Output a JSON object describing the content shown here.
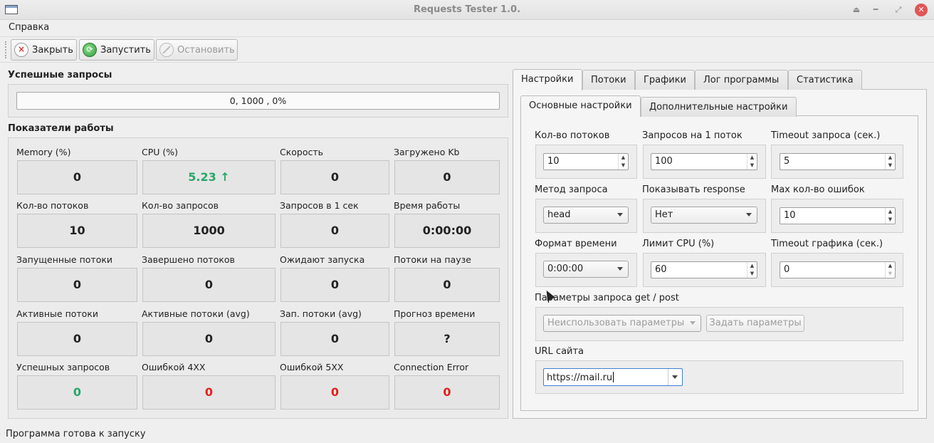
{
  "window": {
    "title": "Requests Tester 1.0."
  },
  "menu": {
    "help": "Справка"
  },
  "toolbar": {
    "close": "Закрыть",
    "run": "Запустить",
    "stop": "Остановить"
  },
  "success_group": {
    "title": "Успешные запросы",
    "progress_text": "0, 1000 , 0%",
    "progress_fraction": 0
  },
  "metrics": {
    "title": "Показатели работы",
    "items": [
      {
        "label": "Memory (%)",
        "value": "0"
      },
      {
        "label": "CPU (%)",
        "value": "5.23 ↑"
      },
      {
        "label": "Скорость",
        "value": "0"
      },
      {
        "label": "Загружено Kb",
        "value": "0"
      },
      {
        "label": "Кол-во потоков",
        "value": "10"
      },
      {
        "label": "Кол-во запросов",
        "value": "1000"
      },
      {
        "label": "Запросов в 1 сек",
        "value": "0"
      },
      {
        "label": "Время работы",
        "value": "0:00:00"
      },
      {
        "label": "Запущенные потоки",
        "value": "0"
      },
      {
        "label": "Завершено потоков",
        "value": "0"
      },
      {
        "label": "Ожидают запуска",
        "value": "0"
      },
      {
        "label": "Потоки на паузе",
        "value": "0"
      },
      {
        "label": "Активные потоки",
        "value": "0"
      },
      {
        "label": "Активные потоки (avg)",
        "value": "0"
      },
      {
        "label": "Зап. потоки (avg)",
        "value": "0"
      },
      {
        "label": "Прогноз времени",
        "value": "?"
      },
      {
        "label": "Успешных запросов",
        "value": "0"
      },
      {
        "label": "Ошибкой 4XX",
        "value": "0"
      },
      {
        "label": "Ошибкой 5XX",
        "value": "0"
      },
      {
        "label": "Connection Error",
        "value": "0"
      }
    ],
    "colors": {
      "green": "#27a86a",
      "red": "#e02020"
    }
  },
  "tabs": [
    "Настройки",
    "Потоки",
    "Графики",
    "Лог программы",
    "Статистика"
  ],
  "subtabs": [
    "Основные настройки",
    "Дополнительные настройки"
  ],
  "settings": {
    "threads": {
      "label": "Кол-во потоков",
      "value": "10"
    },
    "requests_per_thread": {
      "label": "Запросов на 1 поток",
      "value": "100"
    },
    "timeout": {
      "label": "Timeout запроса (сек.)",
      "value": "5"
    },
    "method": {
      "label": "Метод запроса",
      "value": "head"
    },
    "show_response": {
      "label": "Показывать response",
      "value": "Нет"
    },
    "max_errors": {
      "label": "Max кол-во ошибок",
      "value": "10"
    },
    "time_format": {
      "label": "Формат времени",
      "value": "0:00:00"
    },
    "cpu_limit": {
      "label": "Лимит CPU (%)",
      "value": "60"
    },
    "graph_timeout": {
      "label": "Timeout графика (сек.)",
      "value": "0"
    },
    "params": {
      "label": "Параметры запроса get / post",
      "combo": "Неиспользовать параметры",
      "button": "Задать параметры"
    },
    "url": {
      "label": "URL сайта",
      "value": "https://mail.ru"
    }
  },
  "status": {
    "text": "Программа готова к запуску"
  }
}
